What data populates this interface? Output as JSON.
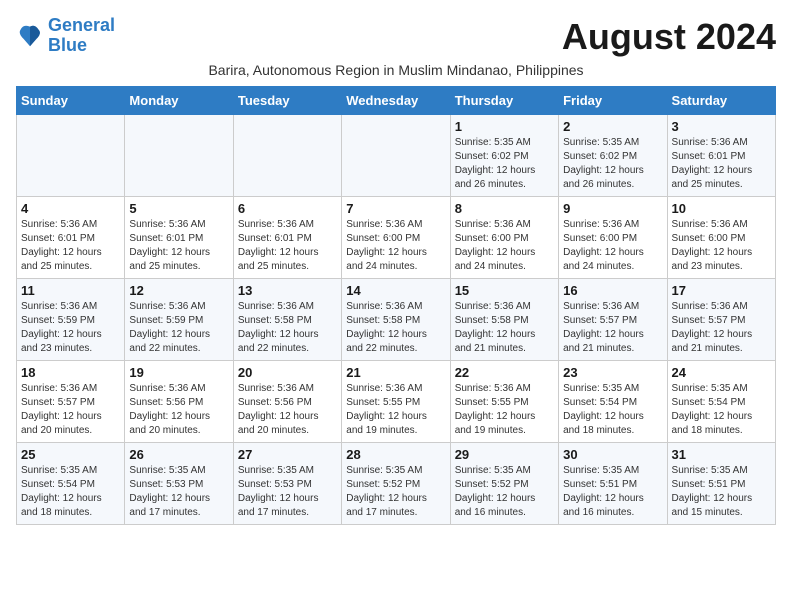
{
  "logo": {
    "line1": "General",
    "line2": "Blue"
  },
  "title": "August 2024",
  "subtitle": "Barira, Autonomous Region in Muslim Mindanao, Philippines",
  "days_header": [
    "Sunday",
    "Monday",
    "Tuesday",
    "Wednesday",
    "Thursday",
    "Friday",
    "Saturday"
  ],
  "weeks": [
    [
      {
        "day": "",
        "info": ""
      },
      {
        "day": "",
        "info": ""
      },
      {
        "day": "",
        "info": ""
      },
      {
        "day": "",
        "info": ""
      },
      {
        "day": "1",
        "info": "Sunrise: 5:35 AM\nSunset: 6:02 PM\nDaylight: 12 hours\nand 26 minutes."
      },
      {
        "day": "2",
        "info": "Sunrise: 5:35 AM\nSunset: 6:02 PM\nDaylight: 12 hours\nand 26 minutes."
      },
      {
        "day": "3",
        "info": "Sunrise: 5:36 AM\nSunset: 6:01 PM\nDaylight: 12 hours\nand 25 minutes."
      }
    ],
    [
      {
        "day": "4",
        "info": "Sunrise: 5:36 AM\nSunset: 6:01 PM\nDaylight: 12 hours\nand 25 minutes."
      },
      {
        "day": "5",
        "info": "Sunrise: 5:36 AM\nSunset: 6:01 PM\nDaylight: 12 hours\nand 25 minutes."
      },
      {
        "day": "6",
        "info": "Sunrise: 5:36 AM\nSunset: 6:01 PM\nDaylight: 12 hours\nand 25 minutes."
      },
      {
        "day": "7",
        "info": "Sunrise: 5:36 AM\nSunset: 6:00 PM\nDaylight: 12 hours\nand 24 minutes."
      },
      {
        "day": "8",
        "info": "Sunrise: 5:36 AM\nSunset: 6:00 PM\nDaylight: 12 hours\nand 24 minutes."
      },
      {
        "day": "9",
        "info": "Sunrise: 5:36 AM\nSunset: 6:00 PM\nDaylight: 12 hours\nand 24 minutes."
      },
      {
        "day": "10",
        "info": "Sunrise: 5:36 AM\nSunset: 6:00 PM\nDaylight: 12 hours\nand 23 minutes."
      }
    ],
    [
      {
        "day": "11",
        "info": "Sunrise: 5:36 AM\nSunset: 5:59 PM\nDaylight: 12 hours\nand 23 minutes."
      },
      {
        "day": "12",
        "info": "Sunrise: 5:36 AM\nSunset: 5:59 PM\nDaylight: 12 hours\nand 22 minutes."
      },
      {
        "day": "13",
        "info": "Sunrise: 5:36 AM\nSunset: 5:58 PM\nDaylight: 12 hours\nand 22 minutes."
      },
      {
        "day": "14",
        "info": "Sunrise: 5:36 AM\nSunset: 5:58 PM\nDaylight: 12 hours\nand 22 minutes."
      },
      {
        "day": "15",
        "info": "Sunrise: 5:36 AM\nSunset: 5:58 PM\nDaylight: 12 hours\nand 21 minutes."
      },
      {
        "day": "16",
        "info": "Sunrise: 5:36 AM\nSunset: 5:57 PM\nDaylight: 12 hours\nand 21 minutes."
      },
      {
        "day": "17",
        "info": "Sunrise: 5:36 AM\nSunset: 5:57 PM\nDaylight: 12 hours\nand 21 minutes."
      }
    ],
    [
      {
        "day": "18",
        "info": "Sunrise: 5:36 AM\nSunset: 5:57 PM\nDaylight: 12 hours\nand 20 minutes."
      },
      {
        "day": "19",
        "info": "Sunrise: 5:36 AM\nSunset: 5:56 PM\nDaylight: 12 hours\nand 20 minutes."
      },
      {
        "day": "20",
        "info": "Sunrise: 5:36 AM\nSunset: 5:56 PM\nDaylight: 12 hours\nand 20 minutes."
      },
      {
        "day": "21",
        "info": "Sunrise: 5:36 AM\nSunset: 5:55 PM\nDaylight: 12 hours\nand 19 minutes."
      },
      {
        "day": "22",
        "info": "Sunrise: 5:36 AM\nSunset: 5:55 PM\nDaylight: 12 hours\nand 19 minutes."
      },
      {
        "day": "23",
        "info": "Sunrise: 5:35 AM\nSunset: 5:54 PM\nDaylight: 12 hours\nand 18 minutes."
      },
      {
        "day": "24",
        "info": "Sunrise: 5:35 AM\nSunset: 5:54 PM\nDaylight: 12 hours\nand 18 minutes."
      }
    ],
    [
      {
        "day": "25",
        "info": "Sunrise: 5:35 AM\nSunset: 5:54 PM\nDaylight: 12 hours\nand 18 minutes."
      },
      {
        "day": "26",
        "info": "Sunrise: 5:35 AM\nSunset: 5:53 PM\nDaylight: 12 hours\nand 17 minutes."
      },
      {
        "day": "27",
        "info": "Sunrise: 5:35 AM\nSunset: 5:53 PM\nDaylight: 12 hours\nand 17 minutes."
      },
      {
        "day": "28",
        "info": "Sunrise: 5:35 AM\nSunset: 5:52 PM\nDaylight: 12 hours\nand 17 minutes."
      },
      {
        "day": "29",
        "info": "Sunrise: 5:35 AM\nSunset: 5:52 PM\nDaylight: 12 hours\nand 16 minutes."
      },
      {
        "day": "30",
        "info": "Sunrise: 5:35 AM\nSunset: 5:51 PM\nDaylight: 12 hours\nand 16 minutes."
      },
      {
        "day": "31",
        "info": "Sunrise: 5:35 AM\nSunset: 5:51 PM\nDaylight: 12 hours\nand 15 minutes."
      }
    ]
  ]
}
